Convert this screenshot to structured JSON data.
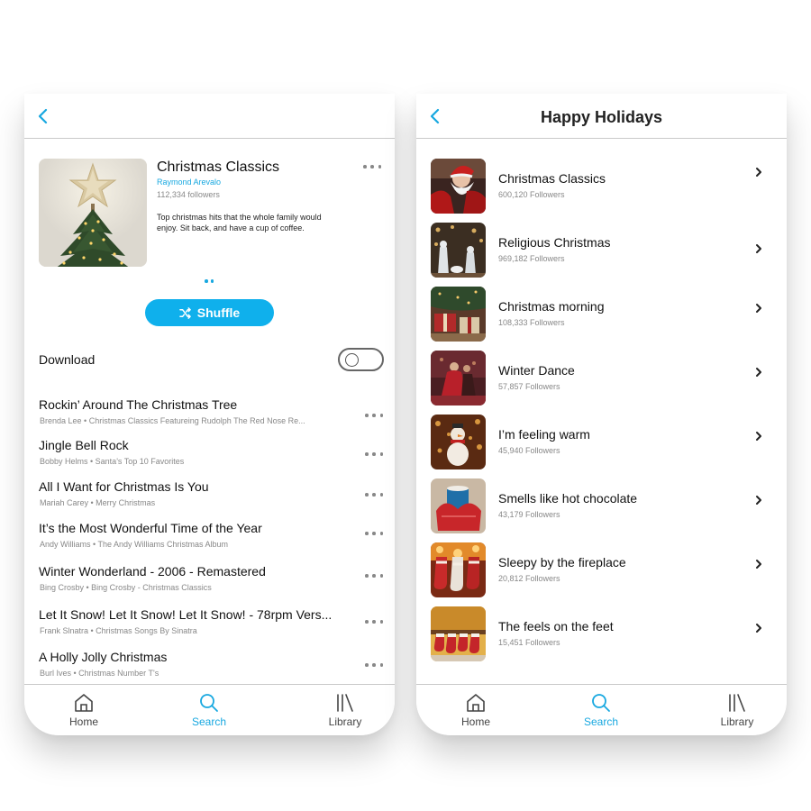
{
  "colors": {
    "accent": "#18a8e0",
    "shuffle": "#0fb0ec",
    "secondary_text": "#888888"
  },
  "tabbar": {
    "home": "Home",
    "search": "Search",
    "library": "Library",
    "active": "Search"
  },
  "left": {
    "playlist": {
      "title": "Christmas Classics",
      "owner": "Raymond Arevalo",
      "followers": "112,334 followers",
      "description": "Top christmas hits that the whole family would enjoy. Sit back, and have a cup of coffee."
    },
    "shuffle_label": "Shuffle",
    "download_label": "Download",
    "download_enabled": false,
    "tracks": [
      {
        "title": "Rockin’ Around The Christmas Tree",
        "subtitle": "Brenda Lee • Christmas Classics Featureing Rudolph The Red Nose Re..."
      },
      {
        "title": "Jingle Bell Rock",
        "subtitle": "Bobby Helms • Santa's Top 10 Favorites"
      },
      {
        "title": "All I Want for Christmas Is You",
        "subtitle": "Mariah Carey • Merry Christmas"
      },
      {
        "title": "It’s the Most Wonderful Time of the Year",
        "subtitle": "Andy Williams • The Andy Williams Christmas Album"
      },
      {
        "title": "Winter Wonderland - 2006 - Remastered",
        "subtitle": "Bing Crosby • Bing Crosby - Christmas Classics"
      },
      {
        "title": "Let It Snow! Let It Snow! Let It Snow! - 78rpm Vers...",
        "subtitle": "Frank Slnatra • Christmas Songs By Sinatra"
      },
      {
        "title": "A Holly Jolly Christmas",
        "subtitle": "Burl Ives • Christmas Number T's"
      }
    ]
  },
  "right": {
    "title": "Happy Holidays",
    "playlists": [
      {
        "title": "Christmas Classics",
        "followers": "600,120  Followers",
        "thumb": "santa"
      },
      {
        "title": "Religious Christmas",
        "followers": "969,182  Followers",
        "thumb": "nativity"
      },
      {
        "title": "Christmas morning",
        "followers": "108,333  Followers",
        "thumb": "presents"
      },
      {
        "title": "Winter Dance",
        "followers": "57,857  Followers",
        "thumb": "dance"
      },
      {
        "title": "I’m feeling warm",
        "followers": "45,940  Followers",
        "thumb": "snowman"
      },
      {
        "title": "Smells like hot chocolate",
        "followers": "43,179  Followers",
        "thumb": "mittens-mug"
      },
      {
        "title": "Sleepy by the fireplace",
        "followers": "20,812  Followers",
        "thumb": "stockings-fireplace"
      },
      {
        "title": "The feels on the feet",
        "followers": "15,451  Followers",
        "thumb": "stockings"
      }
    ]
  }
}
